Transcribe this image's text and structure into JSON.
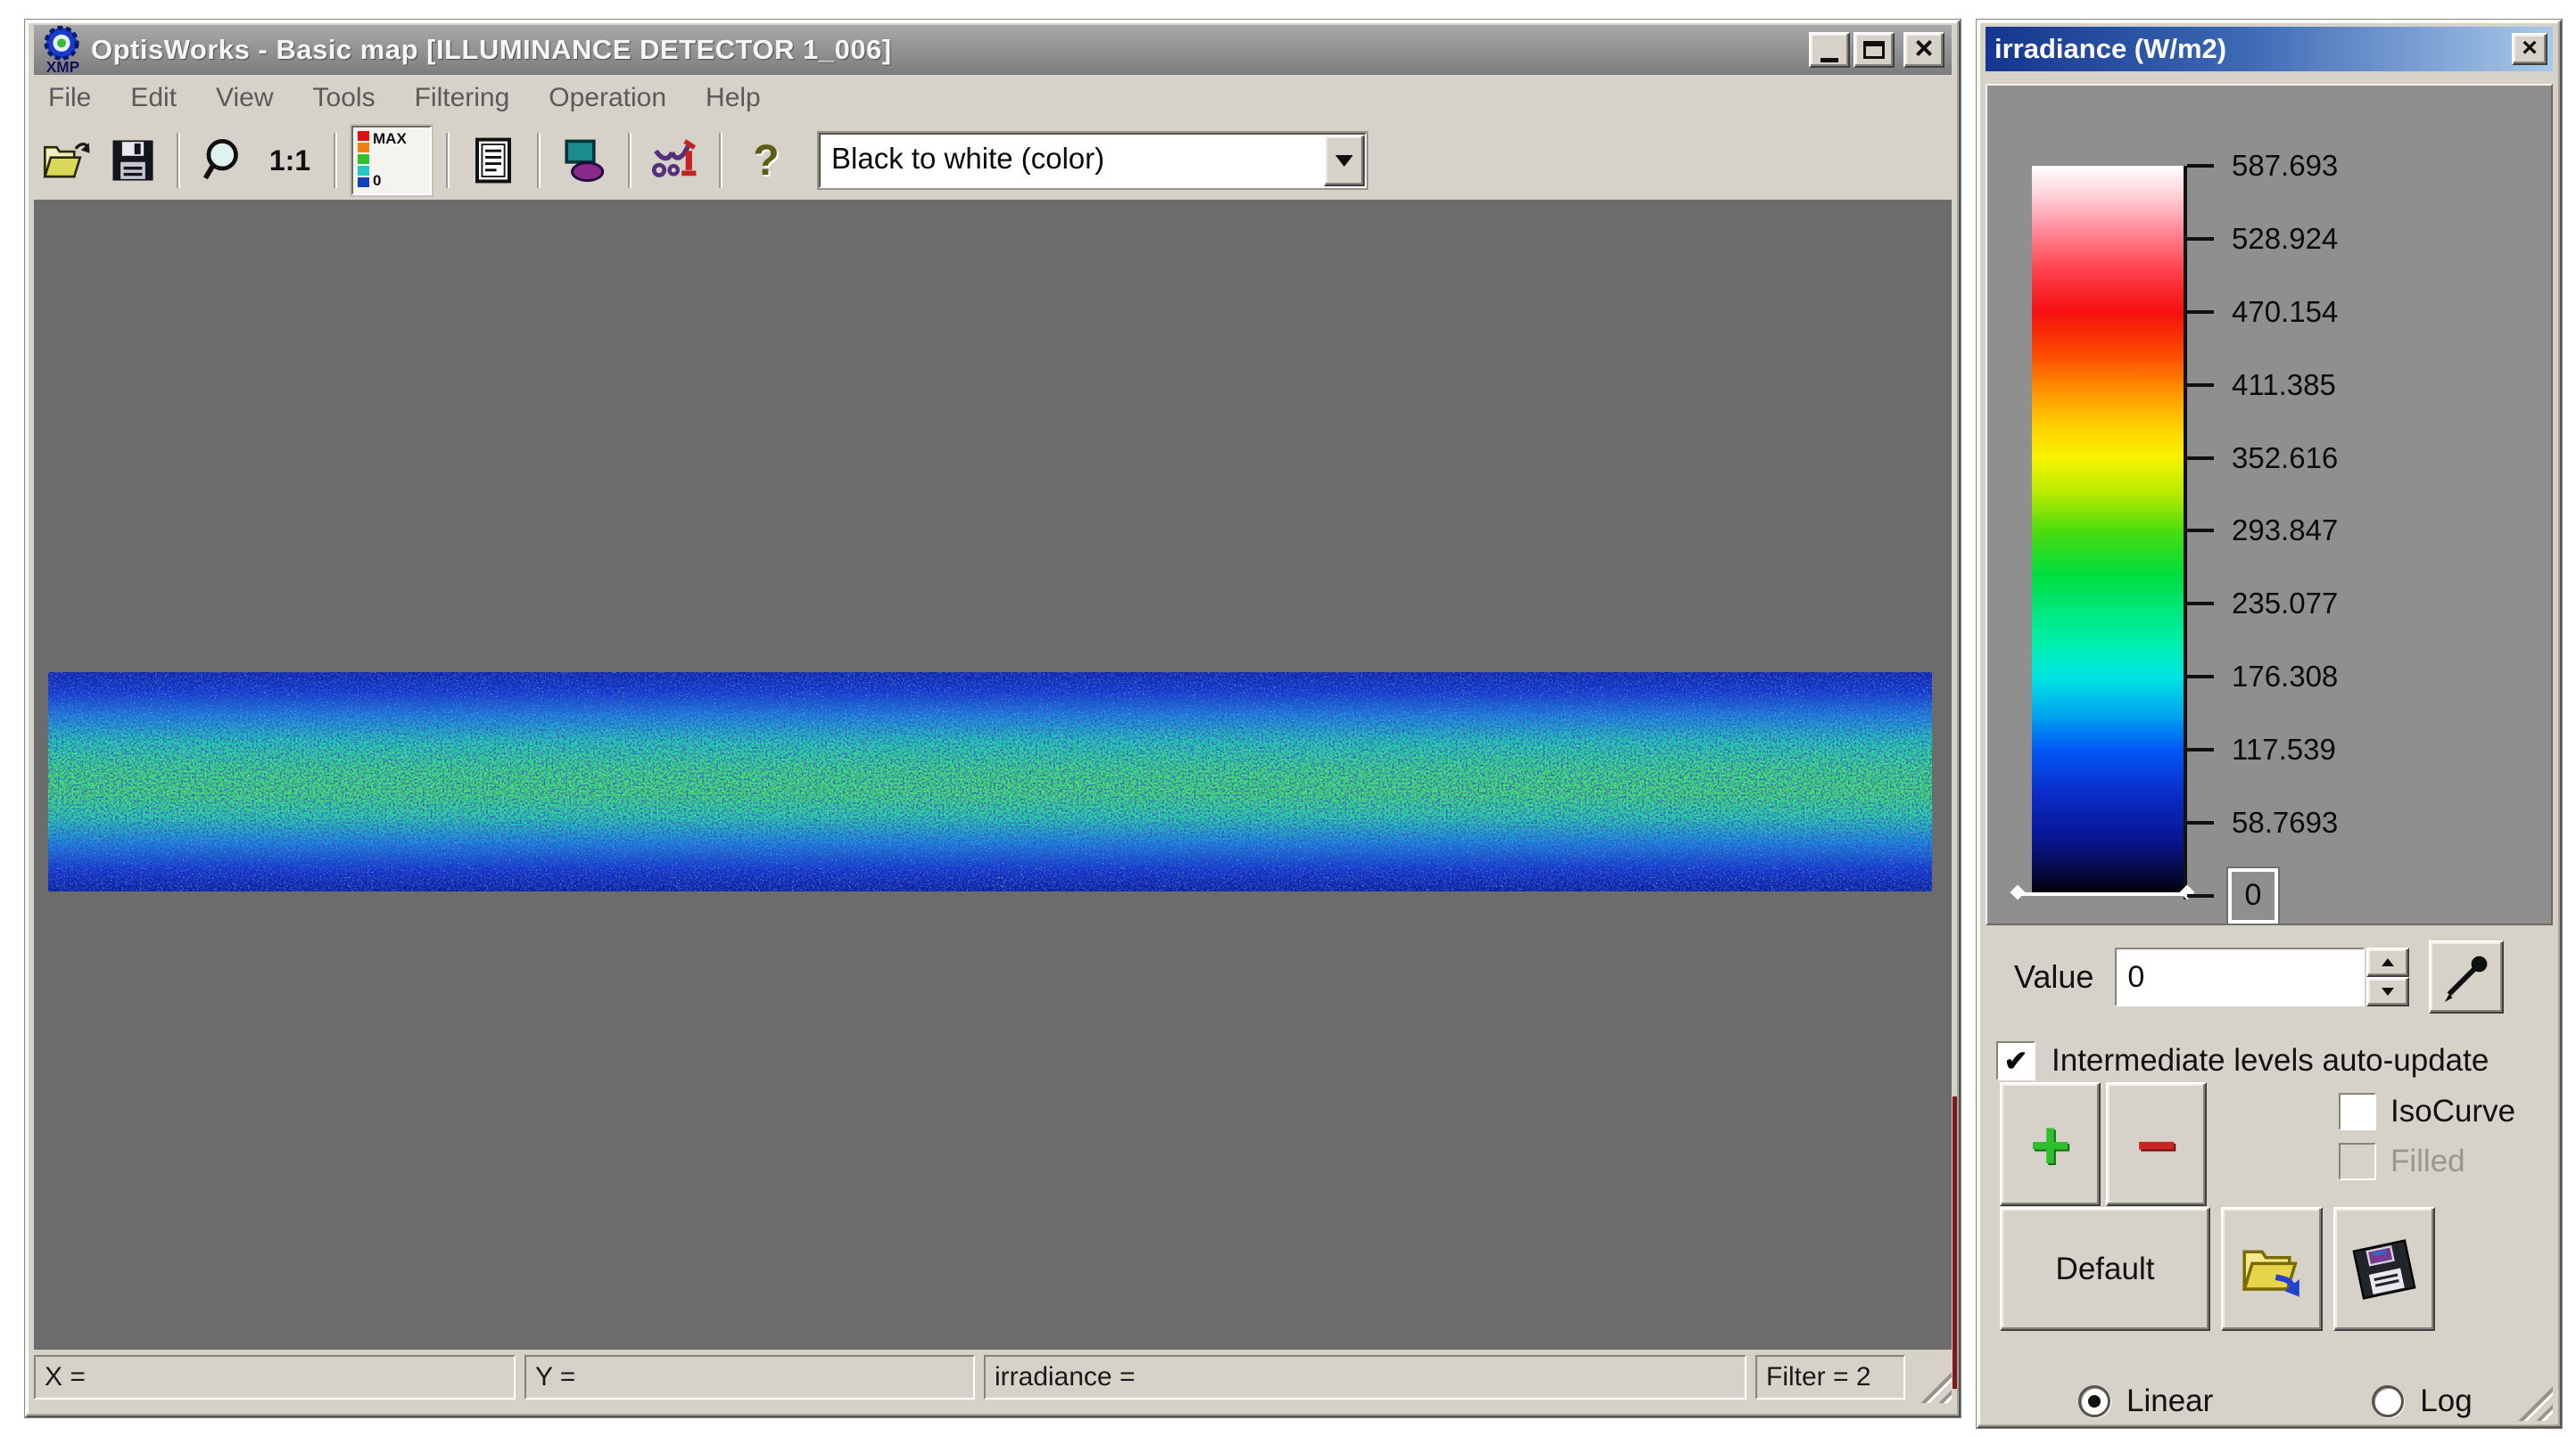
{
  "main_window": {
    "title": "OptisWorks - Basic map [ILLUMINANCE DETECTOR 1_006]",
    "app_icon_text": "XMP",
    "menu_items": [
      "File",
      "Edit",
      "View",
      "Tools",
      "Filtering",
      "Operation",
      "Help"
    ],
    "toolbar": {
      "zoom_ratio_label": "1:1",
      "colorscale_max_label": "MAX",
      "colorscale_min_label": "0",
      "help_glyph": "?",
      "colormap_select_value": "Black to white (color)"
    },
    "status_bar": {
      "x_label": "X =",
      "y_label": "Y =",
      "irradiance_label": "irradiance =",
      "filter_label": "Filter = 2"
    }
  },
  "palette_window": {
    "title": "irradiance (W/m2)",
    "scale_ticks": [
      "587.693",
      "528.924",
      "470.154",
      "411.385",
      "352.616",
      "293.847",
      "235.077",
      "176.308",
      "117.539",
      "58.7693"
    ],
    "scale_zero_label": "0",
    "value_label": "Value",
    "value_input": "0",
    "auto_update_checkbox_label": "Intermediate levels auto-update",
    "auto_update_checked": "✔",
    "isocurve_checkbox_label": "IsoCurve",
    "filled_checkbox_label": "Filled",
    "default_button_label": "Default",
    "plus_button_label": "+",
    "minus_button_label": "−",
    "linear_radio_label": "Linear",
    "log_radio_label": "Log"
  },
  "glyphs": {
    "close": "×"
  },
  "colors": {
    "map_background": "#6c6c6c",
    "window_chrome": "#d6d2ca",
    "palette_title_gradient_start": "#14368e",
    "palette_title_gradient_end": "#a9c9e9",
    "band_low": "#0a20aa",
    "band_mid": "#1a86dd",
    "band_high": "#45e070",
    "colormap_top_to_bottom": [
      "#ffffff",
      "#f50f0f",
      "#ff9500",
      "#f7f400",
      "#4bdc0e",
      "#00e77e",
      "#00e5e2",
      "#0157f5",
      "#091694",
      "#000000"
    ]
  }
}
